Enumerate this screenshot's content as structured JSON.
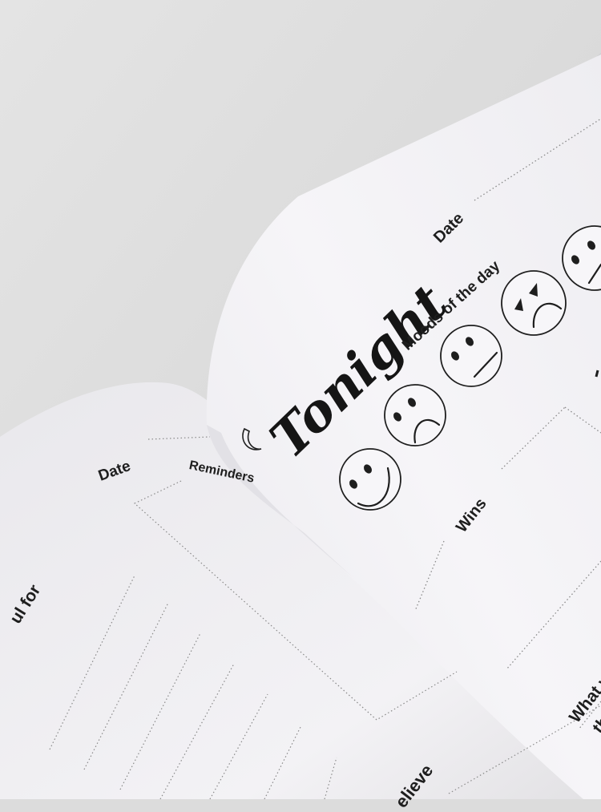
{
  "colors": {
    "background": "#dcdcdc",
    "page": "#f4f3f5",
    "ink": "#1e1e1e",
    "dots": "#8a8a8a"
  },
  "right_page": {
    "date_label": "Date",
    "title": "Tonight",
    "moods_label": "Moods of the day",
    "moods": [
      "happy-face-icon",
      "sad-face-icon",
      "neutral-face-icon",
      "angry-face-icon",
      "grin-face-icon"
    ],
    "wins_label": "Wins",
    "prompt_partial_1": "What w",
    "prompt_partial_2": "the"
  },
  "left_page": {
    "date_label": "Date",
    "reminders_label": "Reminders",
    "grateful_partial": "ul for",
    "believe_partial": "elieve"
  }
}
